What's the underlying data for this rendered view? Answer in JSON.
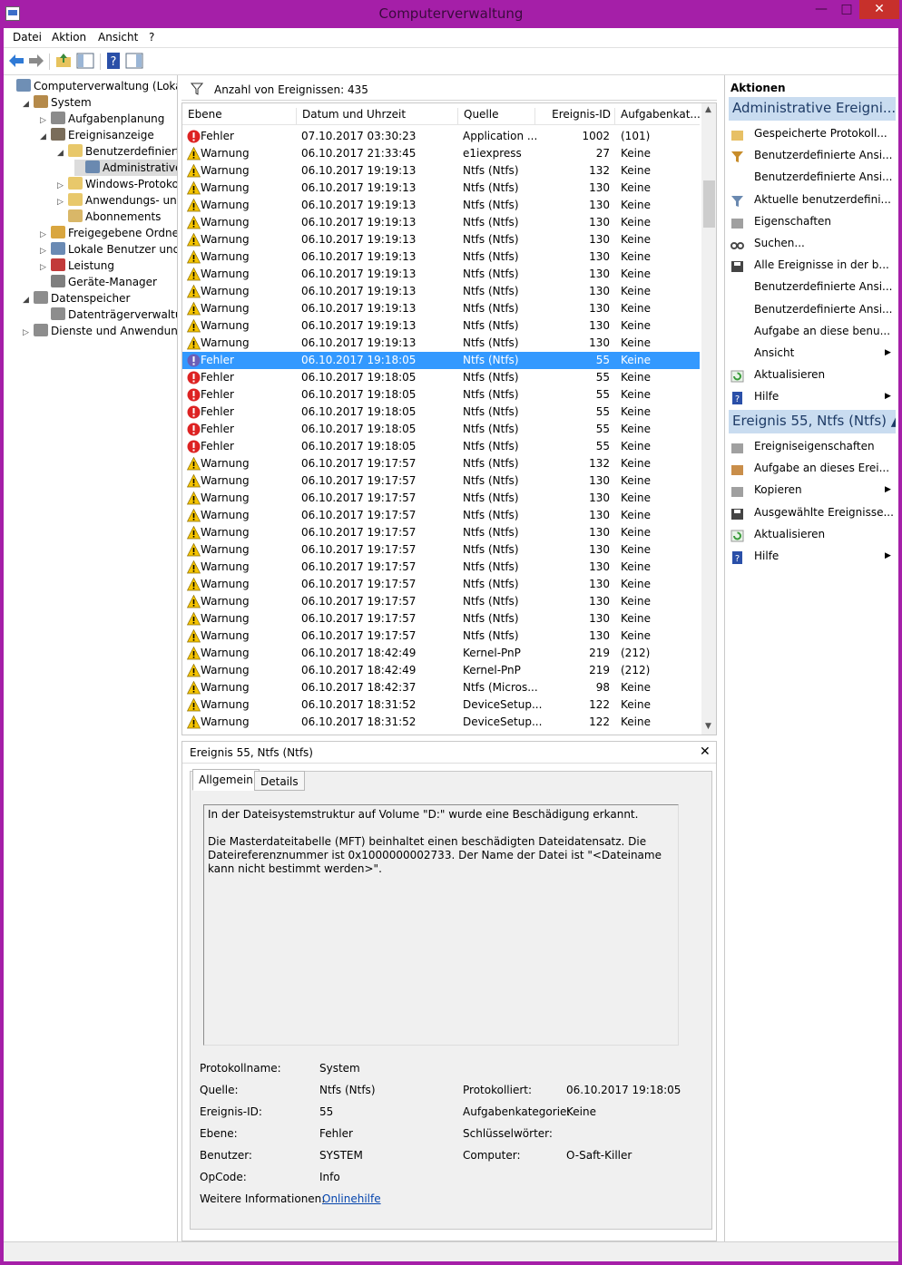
{
  "window": {
    "title": "Computerverwaltung",
    "minimize": "—",
    "maximize": "□",
    "close": "✕"
  },
  "menu": [
    "Datei",
    "Aktion",
    "Ansicht",
    "?"
  ],
  "tree": [
    {
      "label": "Computerverwaltung (Lokal)",
      "indent": 0,
      "arrow": "",
      "icon": "computer-icon",
      "color": "#6f8fb5"
    },
    {
      "label": "System",
      "indent": 1,
      "arrow": "◢",
      "icon": "system-tools-icon",
      "color": "#b58a4a"
    },
    {
      "label": "Aufgabenplanung",
      "indent": 2,
      "arrow": "▷",
      "icon": "task-scheduler-icon",
      "color": "#8b8b8b"
    },
    {
      "label": "Ereignisanzeige",
      "indent": 2,
      "arrow": "◢",
      "icon": "event-viewer-icon",
      "color": "#7a6d5a"
    },
    {
      "label": "Benutzerdefinierte A",
      "indent": 3,
      "arrow": "◢",
      "icon": "folder-icon",
      "color": "#e8c86b"
    },
    {
      "label": "Administrative E",
      "indent": 4,
      "arrow": "",
      "icon": "filter-icon",
      "color": "#6a89b0",
      "selected": true
    },
    {
      "label": "Windows-Protokolle",
      "indent": 3,
      "arrow": "▷",
      "icon": "folder-icon",
      "color": "#e8c86b"
    },
    {
      "label": "Anwendungs- und D",
      "indent": 3,
      "arrow": "▷",
      "icon": "folder-icon",
      "color": "#e8c86b"
    },
    {
      "label": "Abonnements",
      "indent": 3,
      "arrow": "",
      "icon": "subscriptions-icon",
      "color": "#d9b768"
    },
    {
      "label": "Freigegebene Ordner",
      "indent": 2,
      "arrow": "▷",
      "icon": "shared-folders-icon",
      "color": "#d9a63f"
    },
    {
      "label": "Lokale Benutzer und Gr",
      "indent": 2,
      "arrow": "▷",
      "icon": "users-icon",
      "color": "#6a8ab4"
    },
    {
      "label": "Leistung",
      "indent": 2,
      "arrow": "▷",
      "icon": "performance-icon",
      "color": "#c23a3a"
    },
    {
      "label": "Geräte-Manager",
      "indent": 2,
      "arrow": "",
      "icon": "device-manager-icon",
      "color": "#7f7f7f"
    },
    {
      "label": "Datenspeicher",
      "indent": 1,
      "arrow": "◢",
      "icon": "storage-icon",
      "color": "#8d8d8d"
    },
    {
      "label": "Datenträgerverwaltung",
      "indent": 2,
      "arrow": "",
      "icon": "disk-management-icon",
      "color": "#8d8d8d"
    },
    {
      "label": "Dienste und Anwendungen",
      "indent": 1,
      "arrow": "▷",
      "icon": "services-icon",
      "color": "#8d8d8d"
    }
  ],
  "events": {
    "count_label": "Anzahl von Ereignissen: 435",
    "columns": [
      "Ebene",
      "Datum und Uhrzeit",
      "Quelle",
      "Ereignis-ID",
      "Aufgabenkat..."
    ],
    "rows": [
      [
        "Fehler",
        "07.10.2017 03:30:23",
        "Application ...",
        "1002",
        "(101)"
      ],
      [
        "Warnung",
        "06.10.2017 21:33:45",
        "e1iexpress",
        "27",
        "Keine"
      ],
      [
        "Warnung",
        "06.10.2017 19:19:13",
        "Ntfs (Ntfs)",
        "132",
        "Keine"
      ],
      [
        "Warnung",
        "06.10.2017 19:19:13",
        "Ntfs (Ntfs)",
        "130",
        "Keine"
      ],
      [
        "Warnung",
        "06.10.2017 19:19:13",
        "Ntfs (Ntfs)",
        "130",
        "Keine"
      ],
      [
        "Warnung",
        "06.10.2017 19:19:13",
        "Ntfs (Ntfs)",
        "130",
        "Keine"
      ],
      [
        "Warnung",
        "06.10.2017 19:19:13",
        "Ntfs (Ntfs)",
        "130",
        "Keine"
      ],
      [
        "Warnung",
        "06.10.2017 19:19:13",
        "Ntfs (Ntfs)",
        "130",
        "Keine"
      ],
      [
        "Warnung",
        "06.10.2017 19:19:13",
        "Ntfs (Ntfs)",
        "130",
        "Keine"
      ],
      [
        "Warnung",
        "06.10.2017 19:19:13",
        "Ntfs (Ntfs)",
        "130",
        "Keine"
      ],
      [
        "Warnung",
        "06.10.2017 19:19:13",
        "Ntfs (Ntfs)",
        "130",
        "Keine"
      ],
      [
        "Warnung",
        "06.10.2017 19:19:13",
        "Ntfs (Ntfs)",
        "130",
        "Keine"
      ],
      [
        "Warnung",
        "06.10.2017 19:19:13",
        "Ntfs (Ntfs)",
        "130",
        "Keine"
      ],
      [
        "Fehler",
        "06.10.2017 19:18:05",
        "Ntfs (Ntfs)",
        "55",
        "Keine"
      ],
      [
        "Fehler",
        "06.10.2017 19:18:05",
        "Ntfs (Ntfs)",
        "55",
        "Keine"
      ],
      [
        "Fehler",
        "06.10.2017 19:18:05",
        "Ntfs (Ntfs)",
        "55",
        "Keine"
      ],
      [
        "Fehler",
        "06.10.2017 19:18:05",
        "Ntfs (Ntfs)",
        "55",
        "Keine"
      ],
      [
        "Fehler",
        "06.10.2017 19:18:05",
        "Ntfs (Ntfs)",
        "55",
        "Keine"
      ],
      [
        "Fehler",
        "06.10.2017 19:18:05",
        "Ntfs (Ntfs)",
        "55",
        "Keine"
      ],
      [
        "Warnung",
        "06.10.2017 19:17:57",
        "Ntfs (Ntfs)",
        "132",
        "Keine"
      ],
      [
        "Warnung",
        "06.10.2017 19:17:57",
        "Ntfs (Ntfs)",
        "130",
        "Keine"
      ],
      [
        "Warnung",
        "06.10.2017 19:17:57",
        "Ntfs (Ntfs)",
        "130",
        "Keine"
      ],
      [
        "Warnung",
        "06.10.2017 19:17:57",
        "Ntfs (Ntfs)",
        "130",
        "Keine"
      ],
      [
        "Warnung",
        "06.10.2017 19:17:57",
        "Ntfs (Ntfs)",
        "130",
        "Keine"
      ],
      [
        "Warnung",
        "06.10.2017 19:17:57",
        "Ntfs (Ntfs)",
        "130",
        "Keine"
      ],
      [
        "Warnung",
        "06.10.2017 19:17:57",
        "Ntfs (Ntfs)",
        "130",
        "Keine"
      ],
      [
        "Warnung",
        "06.10.2017 19:17:57",
        "Ntfs (Ntfs)",
        "130",
        "Keine"
      ],
      [
        "Warnung",
        "06.10.2017 19:17:57",
        "Ntfs (Ntfs)",
        "130",
        "Keine"
      ],
      [
        "Warnung",
        "06.10.2017 19:17:57",
        "Ntfs (Ntfs)",
        "130",
        "Keine"
      ],
      [
        "Warnung",
        "06.10.2017 19:17:57",
        "Ntfs (Ntfs)",
        "130",
        "Keine"
      ],
      [
        "Warnung",
        "06.10.2017 18:42:49",
        "Kernel-PnP",
        "219",
        "(212)"
      ],
      [
        "Warnung",
        "06.10.2017 18:42:49",
        "Kernel-PnP",
        "219",
        "(212)"
      ],
      [
        "Warnung",
        "06.10.2017 18:42:37",
        "Ntfs (Micros...",
        "98",
        "Keine"
      ],
      [
        "Warnung",
        "06.10.2017 18:31:52",
        "DeviceSetup...",
        "122",
        "Keine"
      ],
      [
        "Warnung",
        "06.10.2017 18:31:52",
        "DeviceSetup...",
        "122",
        "Keine"
      ]
    ],
    "selected_row": 13
  },
  "detail": {
    "title": "Ereignis 55, Ntfs (Ntfs)",
    "tabs": [
      "Allgemein",
      "Details"
    ],
    "message": "In der Dateisystemstruktur auf Volume \"D:\" wurde eine Beschädigung erkannt.\n\nDie Masterdateitabelle (MFT) beinhaltet einen beschädigten Dateidatensatz. Die Dateireferenznummer ist 0x1000000002733. Der Name der Datei ist \"<Dateiname kann nicht bestimmt werden>\".",
    "protokollname_label": "Protokollname:",
    "protokollname": "System",
    "quelle_label": "Quelle:",
    "quelle": "Ntfs (Ntfs)",
    "protokolliert_label": "Protokolliert:",
    "protokolliert": "06.10.2017 19:18:05",
    "id_label": "Ereignis-ID:",
    "id": "55",
    "kategorie_label": "Aufgabenkategorie:",
    "kategorie": "Keine",
    "ebene_label": "Ebene:",
    "ebene": "Fehler",
    "schluessel_label": "Schlüsselwörter:",
    "schluessel": "",
    "benutzer_label": "Benutzer:",
    "benutzer": "SYSTEM",
    "computer_label": "Computer:",
    "computer": "O-Saft-Killer",
    "opcode_label": "OpCode:",
    "opcode": "Info",
    "info_label": "Weitere Informationen:",
    "info_link": "Onlinehilfe"
  },
  "actions": {
    "header": "Aktionen",
    "section1": "Administrative Ereigni... ▲",
    "items1": [
      {
        "label": "Gespeicherte Protokoll...",
        "icon": "open-folder-icon",
        "color": "#e3b54a"
      },
      {
        "label": "Benutzerdefinierte Ansi...",
        "icon": "filter-icon",
        "color": "#c78c2a"
      },
      {
        "label": "Benutzerdefinierte Ansi...",
        "icon": "",
        "color": ""
      },
      {
        "label": "Aktuelle benutzerdefini...",
        "icon": "filter-icon",
        "color": "#6a89b0"
      },
      {
        "label": "Eigenschaften",
        "icon": "properties-icon",
        "color": "#8f8f8f"
      },
      {
        "label": "Suchen...",
        "icon": "find-icon",
        "color": "#4a4a4a"
      },
      {
        "label": "Alle Ereignisse in der b...",
        "icon": "save-icon",
        "color": "#444444"
      },
      {
        "label": "Benutzerdefinierte Ansi...",
        "icon": "",
        "color": ""
      },
      {
        "label": "Benutzerdefinierte Ansi...",
        "icon": "",
        "color": ""
      },
      {
        "label": "Aufgabe an diese benu...",
        "icon": "",
        "color": ""
      },
      {
        "label": "Ansicht",
        "icon": "",
        "color": "",
        "sub": "▶"
      },
      {
        "label": "Aktualisieren",
        "icon": "refresh-icon",
        "color": "#3a9a3a"
      },
      {
        "label": "Hilfe",
        "icon": "help-icon",
        "color": "#2a4fa8",
        "sub": "▶"
      }
    ],
    "section2": "Ereignis 55, Ntfs (Ntfs) ▲",
    "items2": [
      {
        "label": "Ereigniseigenschaften",
        "icon": "properties-icon",
        "color": "#8f8f8f"
      },
      {
        "label": "Aufgabe an dieses Erei...",
        "icon": "task-icon",
        "color": "#c07a2a"
      },
      {
        "label": "Kopieren",
        "icon": "copy-icon",
        "color": "#8f8f8f",
        "sub": "▶"
      },
      {
        "label": "Ausgewählte Ereignisse...",
        "icon": "save-icon",
        "color": "#444444"
      },
      {
        "label": "Aktualisieren",
        "icon": "refresh-icon",
        "color": "#3a9a3a"
      },
      {
        "label": "Hilfe",
        "icon": "help-icon",
        "color": "#2a4fa8",
        "sub": "▶"
      }
    ]
  },
  "colors": {
    "titlebar": "#a51fa8",
    "selection": "#3399ff",
    "error": "#d22",
    "warning": "#f5c400",
    "section": "#c9dcf0"
  }
}
